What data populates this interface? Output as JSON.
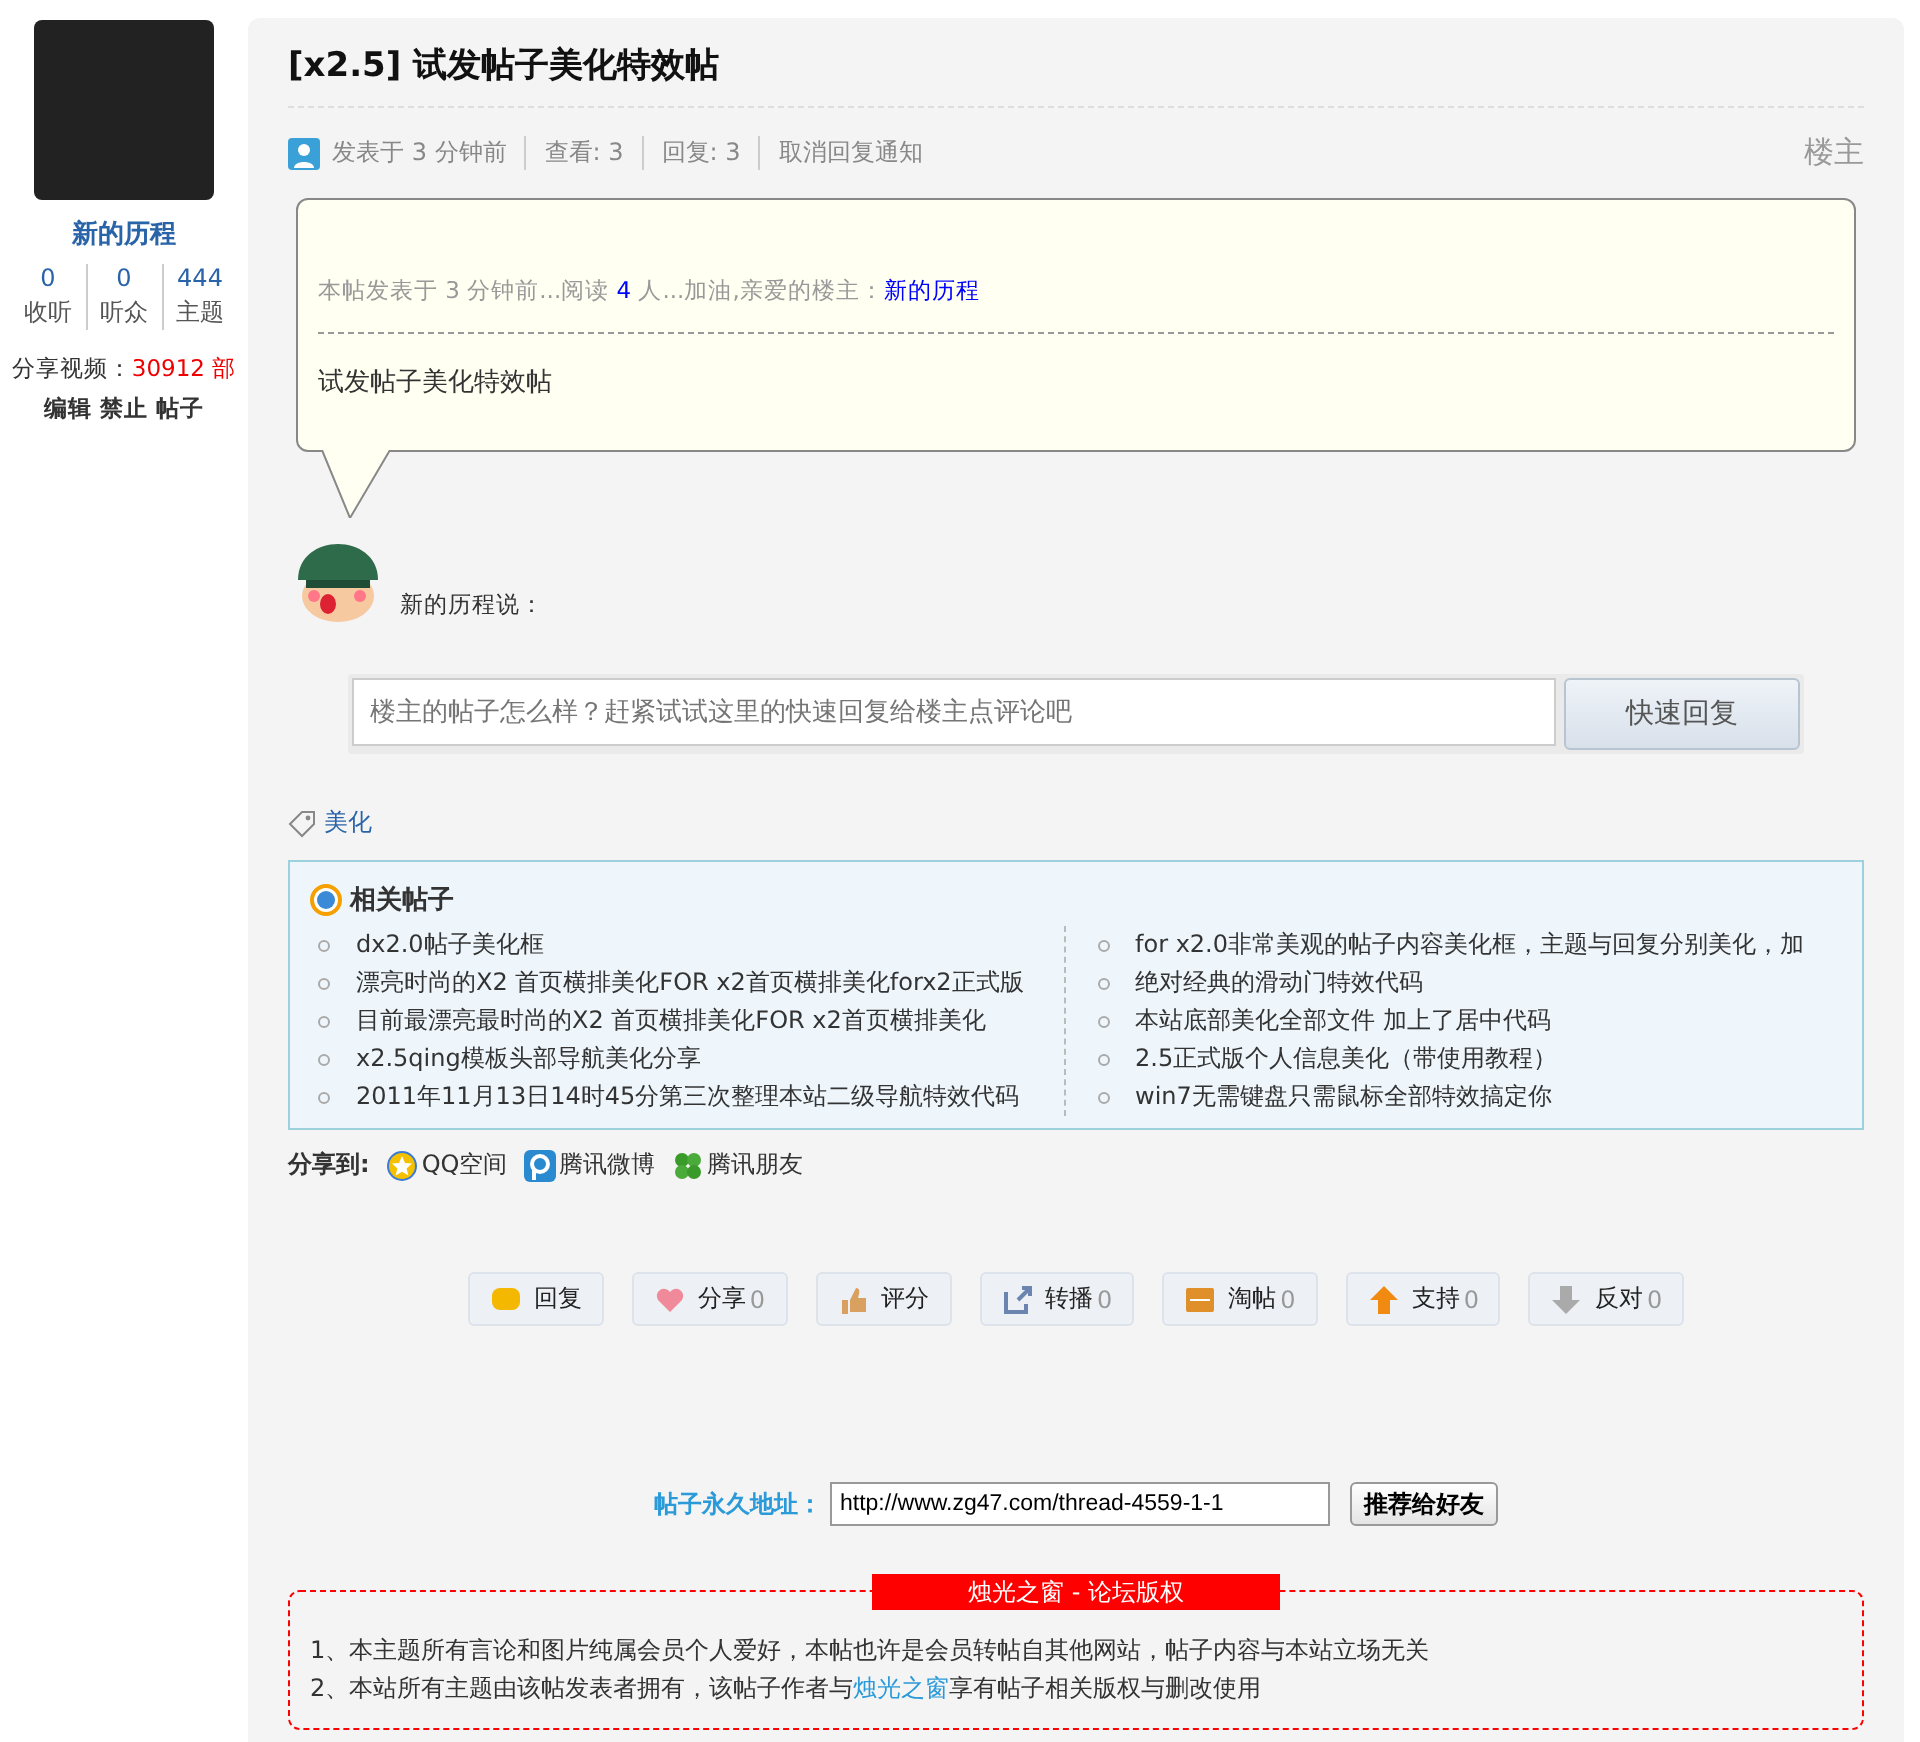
{
  "author": {
    "name": "新的历程",
    "stats": [
      {
        "value": "0",
        "label": "收听"
      },
      {
        "value": "0",
        "label": "听众"
      },
      {
        "value": "444",
        "label": "主题"
      }
    ],
    "share_videos_label": "分享视频：",
    "share_videos_value": "30912 部",
    "actions": [
      "编辑",
      "禁止",
      "帖子"
    ]
  },
  "post": {
    "title": "[x2.5] 试发帖子美化特效帖",
    "meta": [
      "发表于 3 分钟前",
      "查看: 3",
      "回复: 3"
    ],
    "unsubscribe": "取消回复通知",
    "floor": "楼主",
    "notice": {
      "prefix": "本帖发表于 3 分钟前...阅读 ",
      "count": "4",
      "middle": " 人...加油,亲爱的楼主：",
      "author_link": "新的历程"
    },
    "body": "试发帖子美化特效帖",
    "says": "新的历程说：",
    "quick_reply": {
      "placeholder": "楼主的帖子怎么样？赶紧试试这里的快速回复给楼主点评论吧",
      "button": "快速回复"
    },
    "tag": "美化",
    "related": {
      "title": "相关帖子",
      "left": [
        "dx2.0帖子美化框",
        "漂亮时尚的X2 首页横排美化FOR x2首页横排美化forx2正式版",
        "目前最漂亮最时尚的X2 首页横排美化FOR x2首页横排美化",
        "x2.5qing模板头部导航美化分享",
        "2011年11月13日14时45分第三次整理本站二级导航特效代码"
      ],
      "right": [
        "for x2.0非常美观的帖子内容美化框，主题与回复分别美化，加",
        "绝对经典的滑动门特效代码",
        "本站底部美化全部文件 加上了居中代码",
        "2.5正式版个人信息美化（带使用教程）",
        "win7无需键盘只需鼠标全部特效搞定你"
      ]
    },
    "share": {
      "label": "分享到:",
      "targets": [
        {
          "kind": "qzone",
          "label": "QQ空间"
        },
        {
          "kind": "weibo",
          "label": "腾讯微博"
        },
        {
          "kind": "friends",
          "label": "腾讯朋友"
        }
      ]
    },
    "actions": [
      {
        "kind": "reply",
        "label": "回复"
      },
      {
        "kind": "share",
        "label": "分享",
        "count": "0"
      },
      {
        "kind": "rate",
        "label": "评分"
      },
      {
        "kind": "forward",
        "label": "转播",
        "count": "0"
      },
      {
        "kind": "collect",
        "label": "淘帖",
        "count": "0"
      },
      {
        "kind": "support",
        "label": "支持",
        "count": "0"
      },
      {
        "kind": "oppose",
        "label": "反对",
        "count": "0"
      }
    ],
    "permalink": {
      "label": "帖子永久地址：",
      "value": "http://www.zg47.com/thread-4559-1-1",
      "button": "推荐给好友"
    },
    "copyright": {
      "title": "烛光之窗 - 论坛版权",
      "lines": [
        {
          "text": "1、本主题所有言论和图片纯属会员个人爱好，本帖也许是会员转帖自其他网站，帖子内容与本站立场无关"
        },
        {
          "text": "2、本站所有主题由该帖发表者拥有，该帖子作者与",
          "link": "烛光之窗",
          "after": "享有帖子相关版权与删改使用"
        }
      ]
    }
  }
}
